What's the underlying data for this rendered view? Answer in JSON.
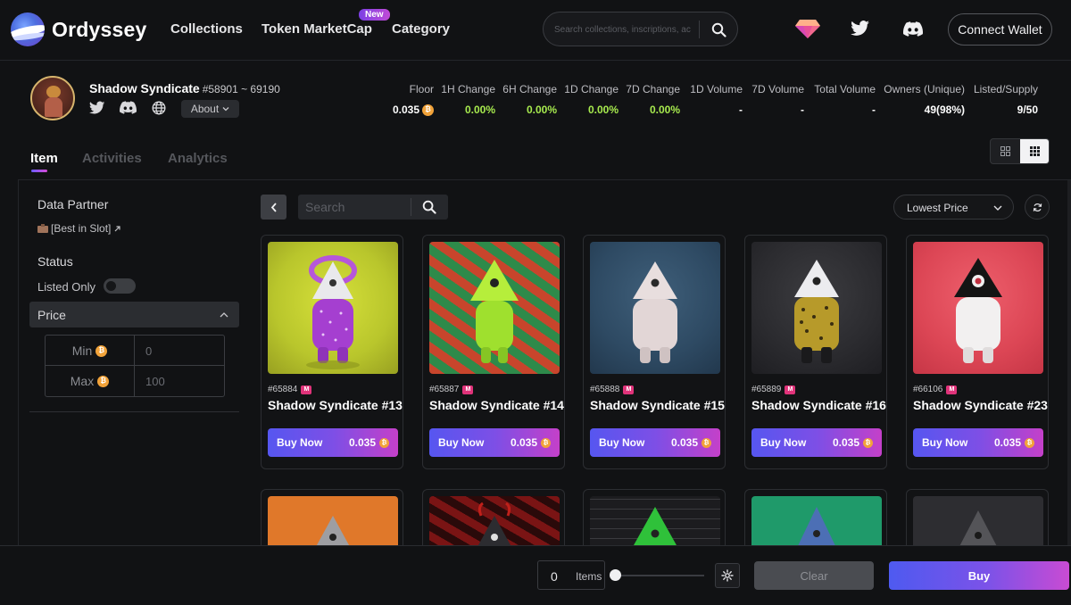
{
  "nav": {
    "brand": "Ordyssey",
    "links": [
      "Collections",
      "Token MarketCap",
      "Category"
    ],
    "new_badge": "New",
    "search_placeholder": "Search collections, inscriptions, ac",
    "connect_label": "Connect Wallet"
  },
  "collection": {
    "name": "Shadow Syndicate",
    "range": "#58901 ~ 69190",
    "about_label": "About",
    "stats": [
      {
        "label": "Floor",
        "value": "0.035",
        "btc": true,
        "green": false
      },
      {
        "label": "1H Change",
        "value": "0.00%",
        "btc": false,
        "green": true
      },
      {
        "label": "6H Change",
        "value": "0.00%",
        "btc": false,
        "green": true
      },
      {
        "label": "1D Change",
        "value": "0.00%",
        "btc": false,
        "green": true
      },
      {
        "label": "7D Change",
        "value": "0.00%",
        "btc": false,
        "green": true
      },
      {
        "label": "1D Volume",
        "value": "-",
        "btc": false,
        "green": false
      },
      {
        "label": "7D Volume",
        "value": "-",
        "btc": false,
        "green": false
      },
      {
        "label": "Total Volume",
        "value": "-",
        "btc": false,
        "green": false
      },
      {
        "label": "Owners (Unique)",
        "value": "49(98%)",
        "btc": false,
        "green": false
      },
      {
        "label": "Listed/Supply",
        "value": "9/50",
        "btc": false,
        "green": false
      }
    ]
  },
  "tabs": [
    "Item",
    "Activities",
    "Analytics"
  ],
  "sidebar": {
    "data_partner_title": "Data Partner",
    "data_partner_link": "[Best in Slot]",
    "status_title": "Status",
    "listed_only_label": "Listed Only",
    "price_title": "Price",
    "min_label": "Min",
    "max_label": "Max",
    "min_placeholder": "0",
    "max_placeholder": "100"
  },
  "toolbar": {
    "search_placeholder": "Search",
    "sort_label": "Lowest Price"
  },
  "cards": [
    {
      "inscription": "#65884",
      "title": "Shadow Syndicate #13",
      "buy_label": "Buy Now",
      "price": "0.035"
    },
    {
      "inscription": "#65887",
      "title": "Shadow Syndicate #14",
      "buy_label": "Buy Now",
      "price": "0.035"
    },
    {
      "inscription": "#65888",
      "title": "Shadow Syndicate #15",
      "buy_label": "Buy Now",
      "price": "0.035"
    },
    {
      "inscription": "#65889",
      "title": "Shadow Syndicate #16",
      "buy_label": "Buy Now",
      "price": "0.035"
    },
    {
      "inscription": "#66106",
      "title": "Shadow Syndicate #23",
      "buy_label": "Buy Now",
      "price": "0.035"
    }
  ],
  "bottom": {
    "count": "0",
    "items_label": "Items",
    "clear_label": "Clear",
    "buy_label": "Buy"
  },
  "colors": {
    "accent_gradient_start": "#5656f0",
    "accent_gradient_end": "#c440c9",
    "positive": "#a7ea4e",
    "btc": "#f2a33a"
  }
}
